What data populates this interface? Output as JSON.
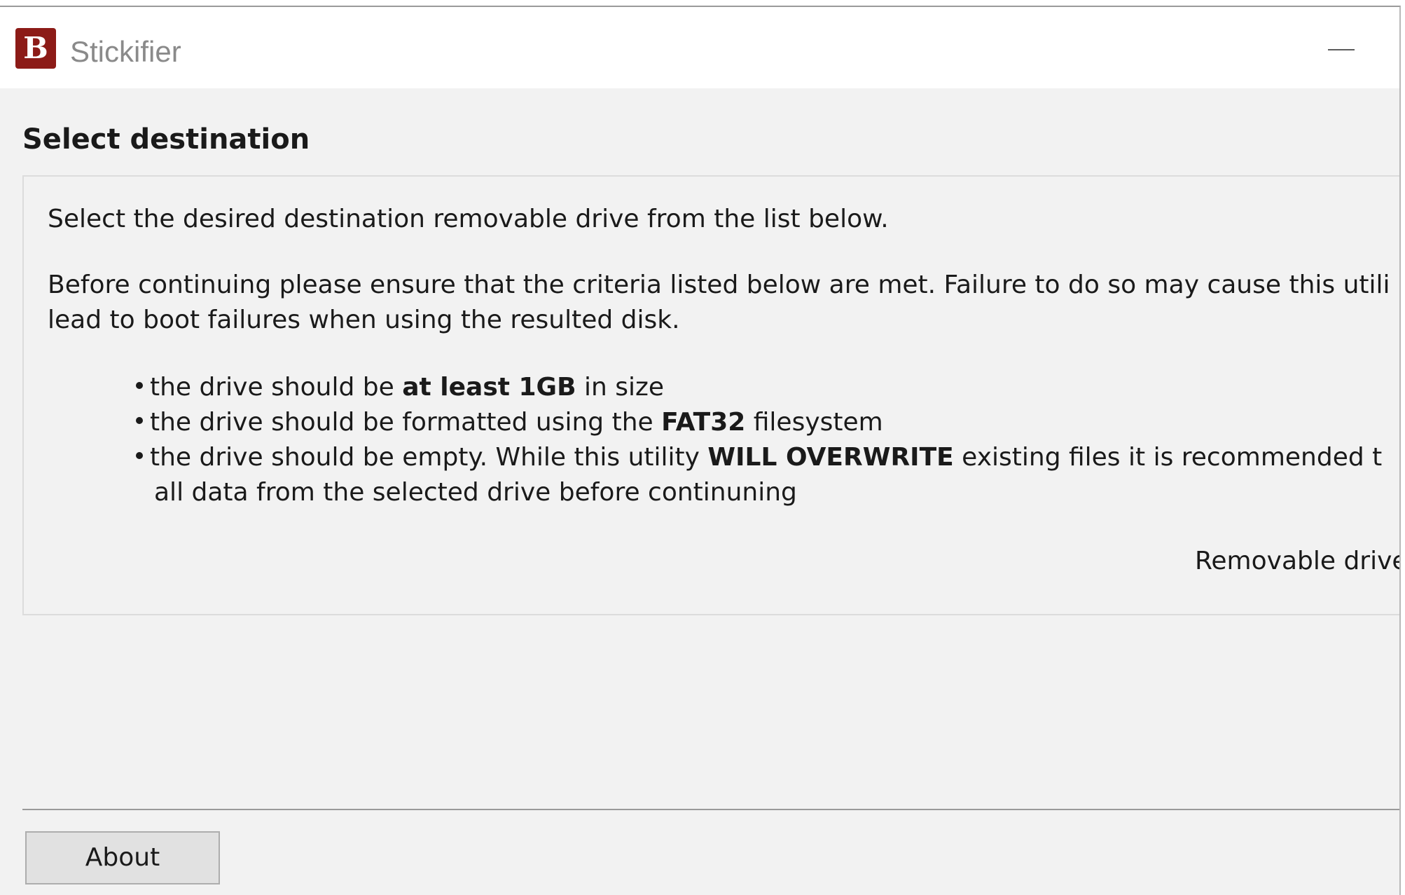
{
  "window": {
    "title": "Stickifier",
    "icon_letter": "B",
    "icon_color": "#8c1b17"
  },
  "page": {
    "section_title": "Select destination",
    "intro": "Select the desired destination removable drive from the list below.",
    "warning_line1": "Before continuing please ensure that the criteria listed below are met. Failure to do so may cause this utili",
    "warning_line2": "lead to boot failures when using the resulted disk.",
    "criteria": [
      {
        "before": "the drive should be ",
        "bold": "at least 1GB",
        "after": " in size"
      },
      {
        "before": "the drive should be formatted using the ",
        "bold": "FAT32",
        "after": " filesystem"
      },
      {
        "before": "the drive should be empty. While this utility ",
        "bold": "WILL OVERWRITE",
        "after": " existing files it is recommended t",
        "continuation": "all data from the selected drive before continuning"
      }
    ],
    "drive_label": "Removable drive"
  },
  "footer": {
    "about_label": "About"
  }
}
